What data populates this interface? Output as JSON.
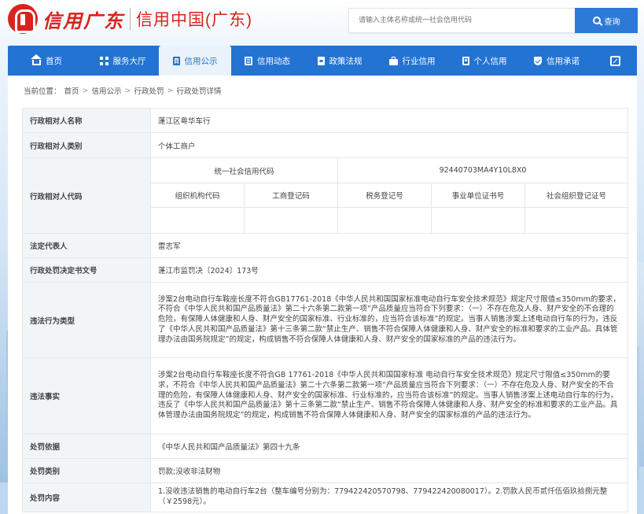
{
  "header": {
    "brand": "信用广东",
    "sub_title": "信用中国(广东)",
    "search_placeholder": "请输入主体名称或统一社会信用代码",
    "search_button": "查询"
  },
  "nav": {
    "items": [
      {
        "label": "首页",
        "icon": "home-icon"
      },
      {
        "label": "服务大厅",
        "icon": "grid-icon"
      },
      {
        "label": "信用公示",
        "icon": "document-icon",
        "active": true
      },
      {
        "label": "信用动态",
        "icon": "list-icon"
      },
      {
        "label": "政策法规",
        "icon": "law-icon"
      },
      {
        "label": "行业信用",
        "icon": "briefcase-icon"
      },
      {
        "label": "个人信用",
        "icon": "person-card-icon"
      },
      {
        "label": "信用承诺",
        "icon": "shield-check-icon"
      }
    ]
  },
  "breadcrumb": {
    "prefix": "当前位置：",
    "items": [
      "首页",
      "信用公示",
      "行政处罚",
      "行政处罚详情"
    ],
    "separator": ">"
  },
  "detail": {
    "name_label": "行政相对人名称",
    "name_value": "蓬江区粤华车行",
    "category_label": "行政相对人类别",
    "category_value": "个体工商户",
    "code_label": "行政相对人代码",
    "uscc_label": "统一社会信用代码",
    "uscc_value": "92440703MA4Y10L8X0",
    "code_headers": [
      "组织机构代码",
      "工商登记码",
      "税务登记号",
      "事业单位证书号",
      "社会组织登记证号"
    ],
    "code_values": [
      "",
      "",
      "",
      "",
      ""
    ],
    "legal_rep_label": "法定代表人",
    "legal_rep_value": "雷志军",
    "doc_no_label": "行政处罚决定书文号",
    "doc_no_value": "蓬江市监罚决〔2024〕173号",
    "violation_type_label": "违法行为类型",
    "violation_type_value": "涉案2台电动自行车鞍座长度不符合GB17761-2018《中华人民共和国国家标准电动自行车安全技术规范》规定尺寸限值≤350mm的要求，不符合《中华人民共和国产品质量法》第二十六条第二款第一项“产品质量应当符合下列要求：（一）不存在危及人身、财产安全的不合理的危险，有保障人体健康和人身、财产安全的国家标准、行业标准的，应当符合该标准”的规定。当事人销售涉案上述电动自行车的行为，违反了《中华人民共和国产品质量法》第十三条第二款“禁止生产、销售不符合保障人体健康和人身、财产安全的标准和要求的工业产品。具体管理办法由国务院规定”的规定，构成销售不符合保障人体健康和人身、财产安全的国家标准的产品的违法行为。",
    "facts_label": "违法事实",
    "facts_value": "涉案2台电动自行车鞍座长度不符合GB 17761-2018《中华人民共和国国家标准 电动自行车安全技术规范》规定尺寸限值≤350mm的要求，不符合《中华人民共和国产品质量法》第二十六条第二款第一项“产品质量应当符合下列要求：（一）不存在危及人身、财产安全的不合理的危险，有保障人体健康和人身、财产安全的国家标准、行业标准的，应当符合该标准”的规定。当事人销售涉案上述电动自行车的行为，违反了《中华人民共和国产品质量法》第十三条第二款“禁止生产、销售不符合保障人体健康和人身、财产安全的标准和要求的工业产品。具体管理办法由国务院规定”的规定，构成销售不符合保障人体健康和人身、财产安全的国家标准的产品的违法行为。",
    "basis_label": "处罚依据",
    "basis_value": "《中华人民共和国产品质量法》第四十九条",
    "penalty_type_label": "处罚类别",
    "penalty_type_value": "罚款;没收非法财物",
    "penalty_content_label": "处罚内容",
    "penalty_content_value": "1.没收违法销售的电动自行车2台（整车编号分别为：779422420570798、779422420080017）。2.罚款人民币贰仟伍佰玖拾捌元整（￥2598元）。"
  },
  "colors": {
    "brand_red": "#d9231d",
    "nav_blue": "#2373d3",
    "search_button": "#2d7ad6",
    "label_bg": "#f2f5f8"
  }
}
